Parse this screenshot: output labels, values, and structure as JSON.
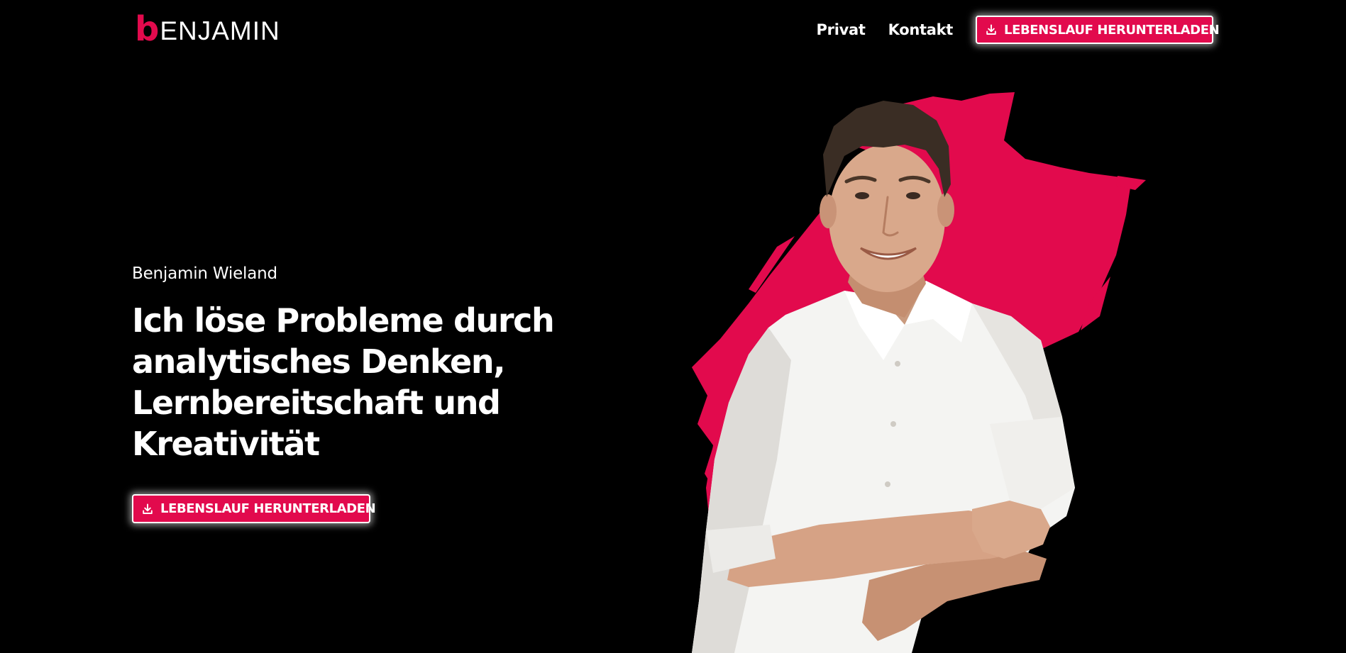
{
  "header": {
    "logo_initial": "b",
    "logo_rest": "ENJAMIN",
    "nav": [
      {
        "label": "Privat"
      },
      {
        "label": "Kontakt"
      }
    ],
    "cta_label": "LEBENSLAUF HERUNTERLADEN"
  },
  "hero": {
    "name": "Benjamin Wieland",
    "headline": "Ich löse Probleme durch analytisches Denken, Lernbereitschaft und Kreativität",
    "cta_label": "LEBENSLAUF HERUNTERLADEN"
  },
  "icons": {
    "download": "download-icon"
  },
  "colors": {
    "background": "#000000",
    "accent": "#e20a4d",
    "text": "#ffffff"
  }
}
